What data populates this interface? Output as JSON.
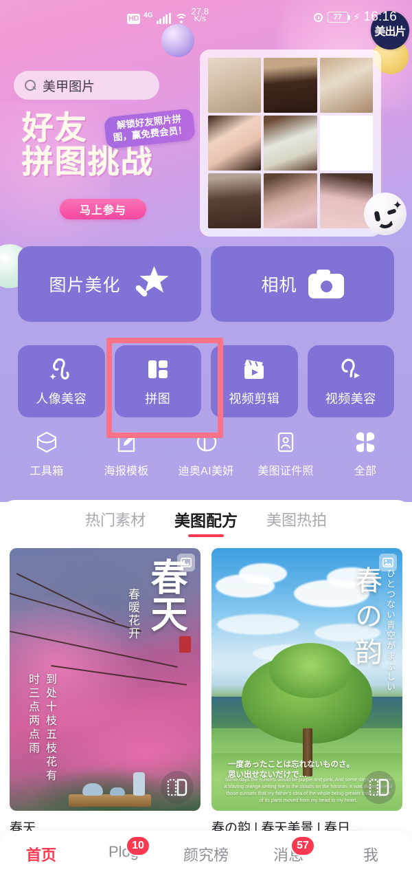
{
  "statusbar": {
    "hd": "HD",
    "network_type": "4G",
    "net_speed": "27.8",
    "net_speed_unit": "K/s",
    "battery": "77",
    "time": "16:16"
  },
  "search": {
    "value": "美甲图片",
    "icon": "search-icon"
  },
  "banner": {
    "title_line1": "好友",
    "title_line2": "拼图挑战",
    "badge_text": "解锁好友照片拼图，赢免费会员！",
    "cta_label": "马上参与",
    "brand_badge": "美出片"
  },
  "big_buttons": [
    {
      "label": "图片美化",
      "icon": "magic-wand-icon"
    },
    {
      "label": "相机",
      "icon": "camera-icon"
    }
  ],
  "small_buttons": [
    {
      "label": "人像美容",
      "icon": "portrait-beauty-icon"
    },
    {
      "label": "拼图",
      "icon": "collage-icon"
    },
    {
      "label": "视频剪辑",
      "icon": "video-edit-icon"
    },
    {
      "label": "视频美容",
      "icon": "video-beauty-icon"
    }
  ],
  "icon_row": [
    {
      "label": "工具箱",
      "icon": "toolbox-icon"
    },
    {
      "label": "海报模板",
      "icon": "poster-template-icon"
    },
    {
      "label": "迪奥AI美妍",
      "icon": "dior-cd-icon"
    },
    {
      "label": "美图证件照",
      "icon": "id-photo-icon"
    },
    {
      "label": "全部",
      "icon": "grid-all-icon"
    }
  ],
  "tabs": [
    {
      "label": "热门素材",
      "active": false
    },
    {
      "label": "美图配方",
      "active": true
    },
    {
      "label": "美图热拍",
      "active": false
    }
  ],
  "cards": [
    {
      "caption": "春天",
      "title": "春天",
      "subtitle": "春暖花开",
      "poem": "到处十枝五枝花有时三点两点雨",
      "topic_icon": "image-icon",
      "watermark_icon": "collage-watermark-icon"
    },
    {
      "caption": "春の韵 | 春天美景 | 春日...",
      "title": "春の韵",
      "vertical_text": "ひとつない青空がまぶしい",
      "bottom_text_1": "一度あったことは忘れないものさ。",
      "bottom_text_2": "思い出せないだけで…",
      "bottom_text_en": "Some days the sunsets would be purple and pink. And some days they were a blazing orange setting fire to the clouds on the horizon. It was during one of those sunsets that my father's idea of the whole being greater than the sum of its parts moved from my head to my heart.",
      "topic_icon": "image-icon",
      "watermark_icon": "collage-watermark-icon"
    }
  ],
  "bottom_nav": [
    {
      "label": "首页",
      "badge": "",
      "active": true
    },
    {
      "label": "Plog",
      "badge": "10",
      "active": false
    },
    {
      "label": "颜究榜",
      "badge": "",
      "active": false
    },
    {
      "label": "消息",
      "badge": "57",
      "active": false
    },
    {
      "label": "我",
      "badge": "",
      "active": false
    }
  ],
  "annotation": {
    "target": "拼图",
    "color": "#fd7287"
  },
  "colors": {
    "accent_red": "#fb3a52",
    "button_purple": "#8172d6",
    "bg_purple": "#b5a5ea",
    "cta_pink": "#f4479f",
    "highlight_pink": "#fd7287"
  }
}
